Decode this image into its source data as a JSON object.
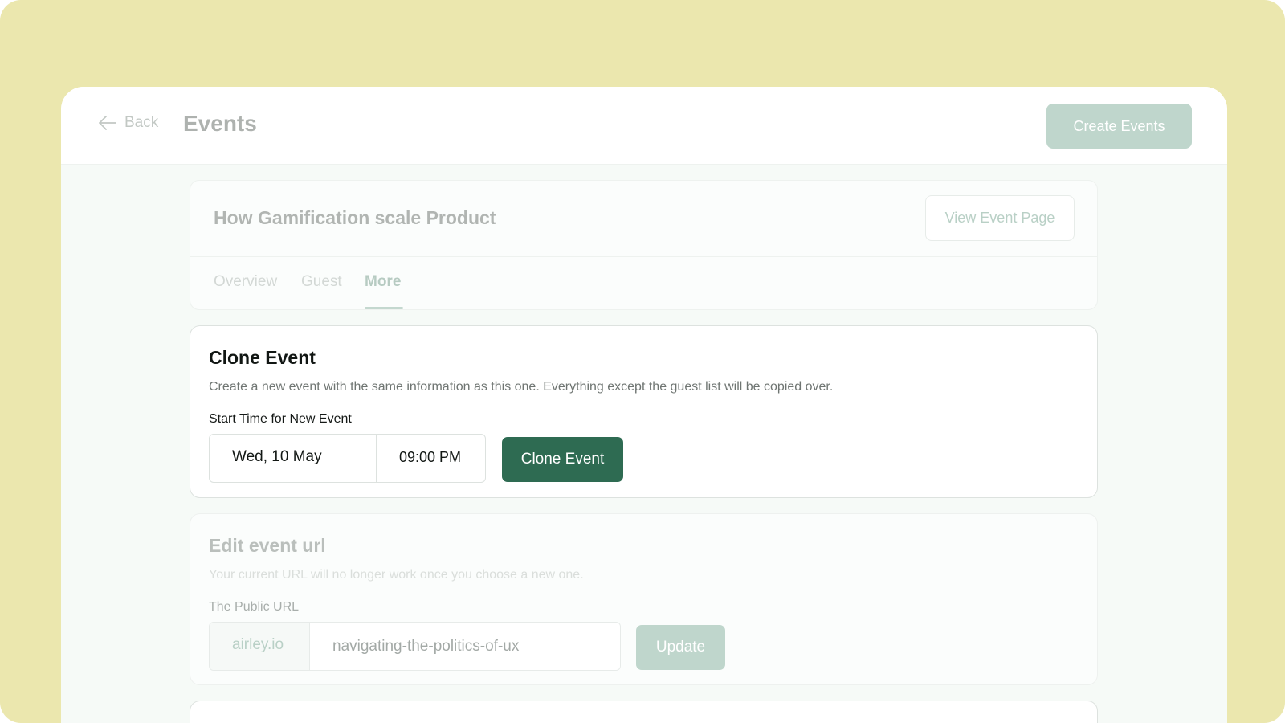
{
  "header": {
    "back_label": "Back",
    "title": "Events",
    "create_button": "Create Events"
  },
  "event": {
    "title": "How Gamification scale Product",
    "view_button": "View Event Page",
    "tabs": [
      {
        "label": "Overview",
        "active": false
      },
      {
        "label": "Guest",
        "active": false
      },
      {
        "label": "More",
        "active": true
      }
    ]
  },
  "clone": {
    "heading": "Clone Event",
    "description": "Create a new event with the same information as this one. Everything except the guest list will be copied over.",
    "start_label": "Start Time for New Event",
    "date_value": "Wed, 10 May",
    "time_value": "09:00 PM",
    "button": "Clone Event"
  },
  "url": {
    "heading": "Edit event url",
    "description": "Your current URL will no longer work once you choose a new one.",
    "label": "The Public URL",
    "prefix": "airley.io",
    "slug": "navigating-the-politics-of-ux",
    "button": "Update"
  },
  "colors": {
    "backdrop": "#ebe7ae",
    "primary_button": "#2e6b52",
    "disabled_button": "#bfd6cc"
  }
}
